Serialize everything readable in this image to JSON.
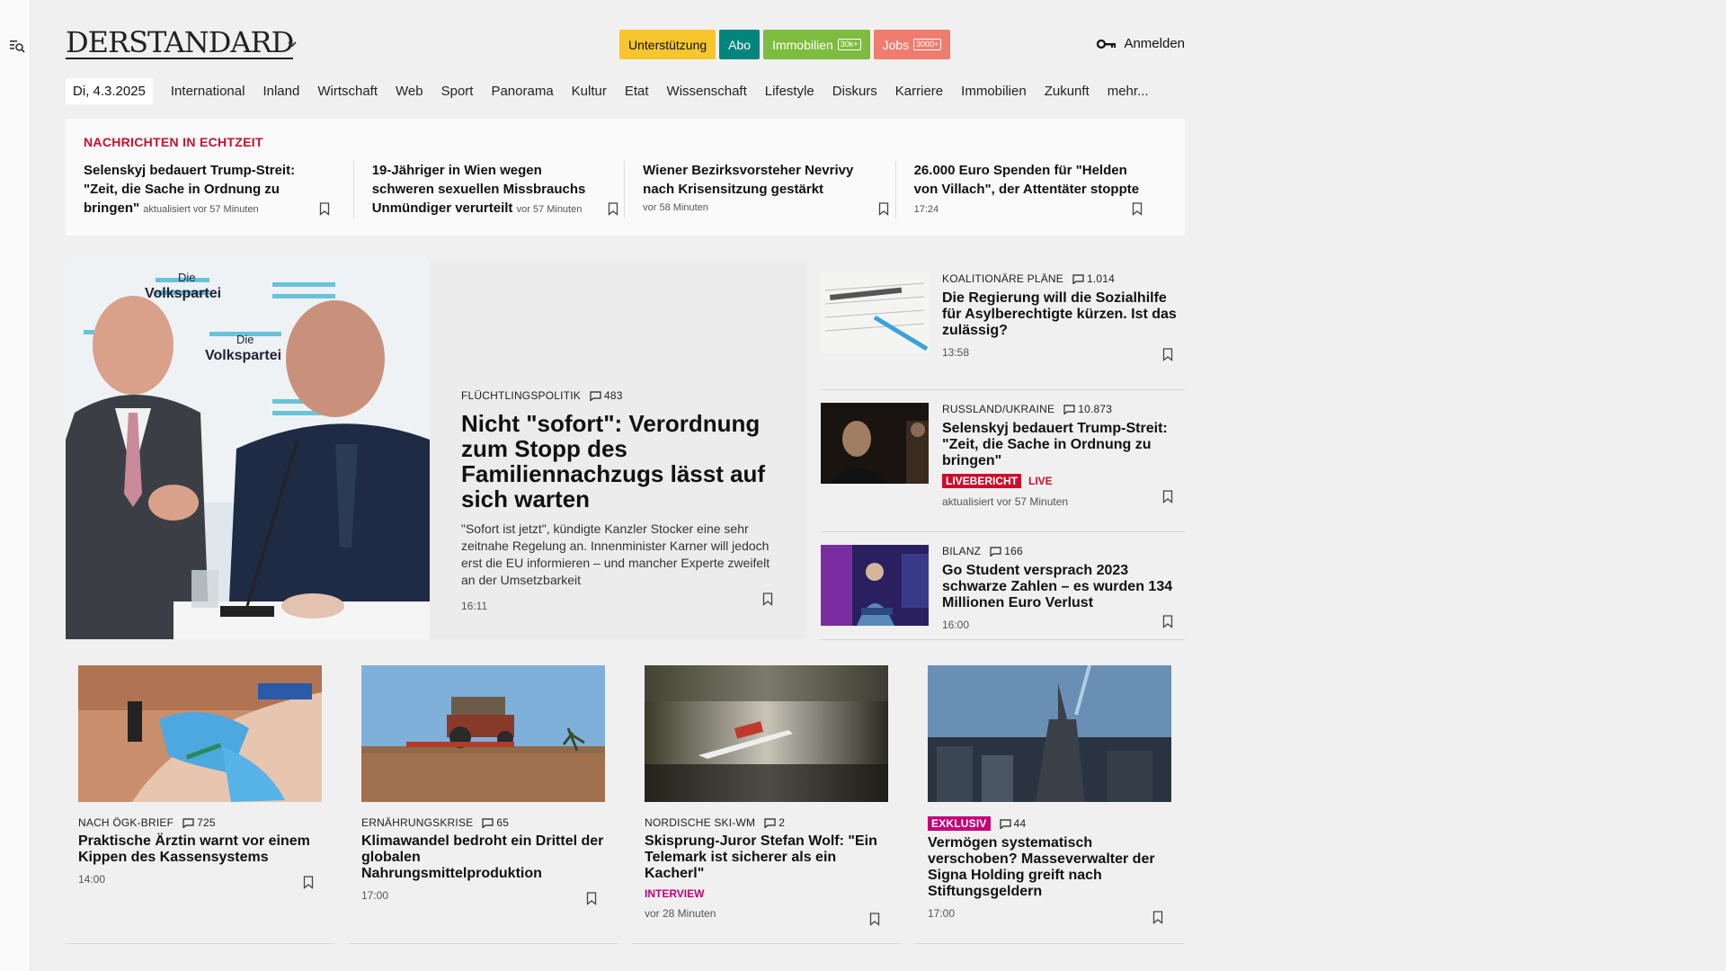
{
  "header": {
    "logo": "DERSTANDARD",
    "pills": {
      "support": "Unterstützung",
      "abo": "Abo",
      "immo": "Immobilien",
      "immo_tag": "30k+",
      "jobs": "Jobs",
      "jobs_tag": "3000+"
    },
    "login": "Anmelden"
  },
  "nav": {
    "date": "Di, 4.3.2025",
    "items": [
      "International",
      "Inland",
      "Wirtschaft",
      "Web",
      "Sport",
      "Panorama",
      "Kultur",
      "Etat",
      "Wissenschaft",
      "Lifestyle",
      "Diskurs",
      "Karriere",
      "Immobilien",
      "Zukunft",
      "mehr..."
    ]
  },
  "ticker": {
    "title": "NACHRICHTEN IN ECHTZEIT",
    "items": [
      {
        "headline": "Selenskyj bedauert Trump-Streit: \"Zeit, die Sache in Ordnung zu bringen\"",
        "time": "aktualisiert vor 57 Minuten"
      },
      {
        "headline": "19-Jähriger in Wien wegen schweren sexuellen Missbrauchs Unmündiger verurteilt",
        "time": "vor 57 Minuten"
      },
      {
        "headline": "Wiener Bezirksvorsteher Nevrivy nach Krisensitzung gestärkt",
        "time": "vor 58 Minuten"
      },
      {
        "headline": "26.000 Euro Spenden für \"Helden von Villach\", der Attentäter stoppte",
        "time": "17:24"
      }
    ]
  },
  "hero": {
    "kicker": "FLÜCHTLINGSPOLITIK",
    "comments": "483",
    "title": "Nicht \"sofort\": Verordnung zum Stopp des Familiennachzugs lässt auf sich warten",
    "teaser": "\"Sofort ist jetzt\", kündigte Kanzler Stocker eine sehr zeitnahe Regelung an. Innenminister Karner will jedoch erst die EU informieren – und mancher Experte zweifelt an der Umsetzbarkeit",
    "time": "16:11",
    "image_text": {
      "party1": "Die",
      "party2": "Volkspartei"
    }
  },
  "side": [
    {
      "kicker": "KOALITIONÄRE PLÄNE",
      "comments": "1.014",
      "title": "Die Regierung will die Sozialhilfe für Asylberechtigte kürzen. Ist das zulässig?",
      "time": "13:58"
    },
    {
      "kicker": "RUSSLAND/UKRAINE",
      "comments": "10.873",
      "title": "Selenskyj bedauert Trump-Streit: \"Zeit, die Sache in Ordnung zu bringen\"",
      "badge": "LIVEBERICHT",
      "live": "LIVE",
      "time": "aktualisiert vor 57 Minuten"
    },
    {
      "kicker": "BILANZ",
      "comments": "166",
      "title": "Go Student versprach 2023 schwarze Zahlen – es wurden 134 Millionen Euro Verlust",
      "time": "16:00"
    }
  ],
  "cards": [
    {
      "kicker": "NACH ÖGK-BRIEF",
      "comments": "725",
      "title": "Praktische Ärztin warnt vor einem Kippen des Kassensystems",
      "time": "14:00"
    },
    {
      "kicker": "ERNÄHRUNGSKRISE",
      "comments": "65",
      "title": "Klimawandel bedroht ein Drittel der globalen Nahrungsmittelproduktion",
      "time": "17:00"
    },
    {
      "kicker": "NORDISCHE SKI-WM",
      "comments": "2",
      "title": "Skisprung-Juror Stefan Wolf: \"Ein Telemark ist sicherer als ein Kacherl\"",
      "label": "INTERVIEW",
      "time": "vor 28 Minuten"
    },
    {
      "badge": "EXKLUSIV",
      "comments": "44",
      "title": "Vermögen systematisch verschoben? Masseverwalter der Signa Holding greift nach Stiftungsgeldern",
      "time": "17:00"
    }
  ],
  "colors": {
    "accent_red": "#c8102e",
    "exklusiv": "#c3007a",
    "support": "#f7c62f",
    "abo": "#00857c",
    "immo": "#7dbc3e",
    "jobs": "#ef7c6e"
  }
}
